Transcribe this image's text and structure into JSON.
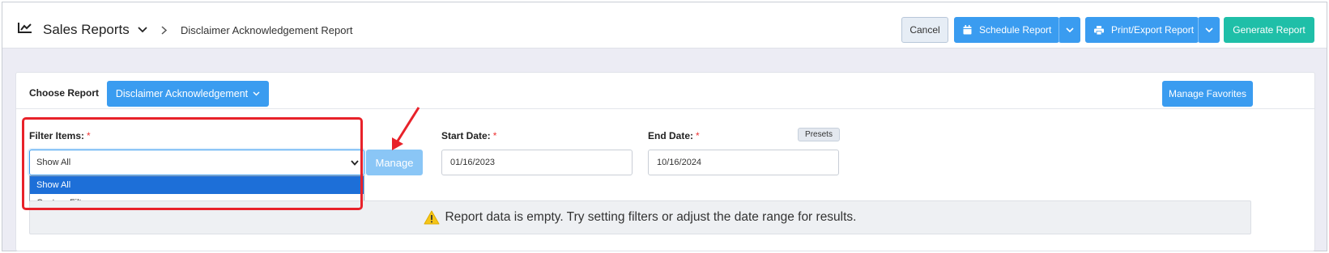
{
  "header": {
    "title": "Sales Reports",
    "current_page": "Disclaimer Acknowledgement Report",
    "buttons": {
      "cancel": "Cancel",
      "schedule": "Schedule Report",
      "print": "Print/Export Report",
      "generate": "Generate Report"
    }
  },
  "report": {
    "choose_label": "Choose Report",
    "selected": "Disclaimer Acknowledgement",
    "manage_favorites": "Manage Favorites"
  },
  "filters": {
    "filter_items_label": "Filter Items:",
    "required_mark": "*",
    "selected": "Show All",
    "options": [
      "Show All",
      "Custom Filter"
    ],
    "manage_label": "Manage",
    "start_date_label": "Start Date:",
    "start_date": "01/16/2023",
    "end_date_label": "End Date:",
    "end_date": "10/16/2024",
    "presets_label": "Presets"
  },
  "notice": {
    "text": "Report data is empty. Try setting filters or adjust the date range for results."
  },
  "colors": {
    "primary": "#3a9cf0",
    "success": "#1fbfa8",
    "annotation": "#e8222a",
    "warning": "#f5c518"
  },
  "icons": {
    "chart": "chart-line-icon",
    "calendar": "calendar-icon",
    "printer": "printer-icon",
    "warning": "warning-icon"
  }
}
